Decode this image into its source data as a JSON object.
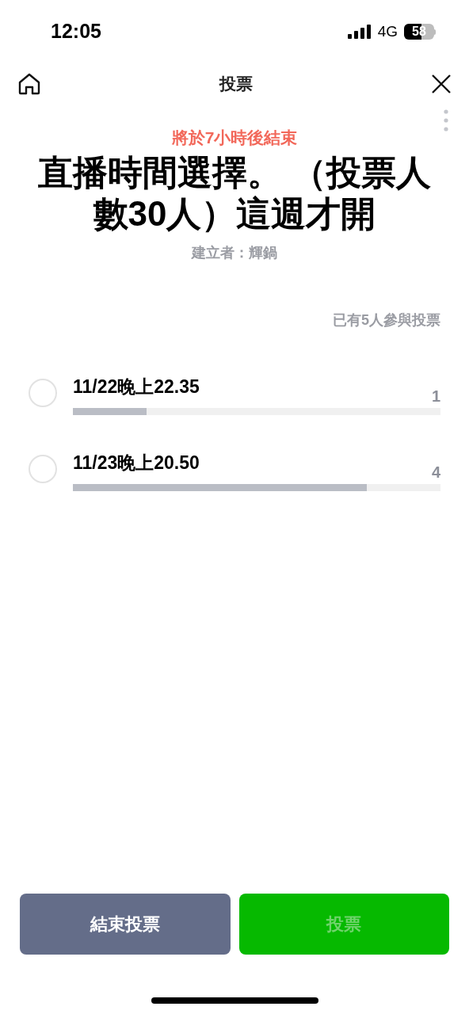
{
  "status_bar": {
    "time": "12:05",
    "network": "4G",
    "battery": "58"
  },
  "header": {
    "title": "投票"
  },
  "poll": {
    "countdown": "將於7小時後結束",
    "title": "直播時間選擇。 （投票人數30人）這週才開",
    "creator": "建立者：輝鍋",
    "participants": "已有5人參與投票",
    "options": [
      {
        "label": "11/22晚上22.35",
        "count": "1",
        "level": 0.2,
        "selected": false
      },
      {
        "label": "11/23晚上20.50",
        "count": "4",
        "level": 0.8,
        "selected": false
      }
    ]
  },
  "buttons": [
    {
      "label": "結束投票",
      "kind": "secondary",
      "disabled": false
    },
    {
      "label": "投票",
      "kind": "primary",
      "disabled": true
    }
  ]
}
